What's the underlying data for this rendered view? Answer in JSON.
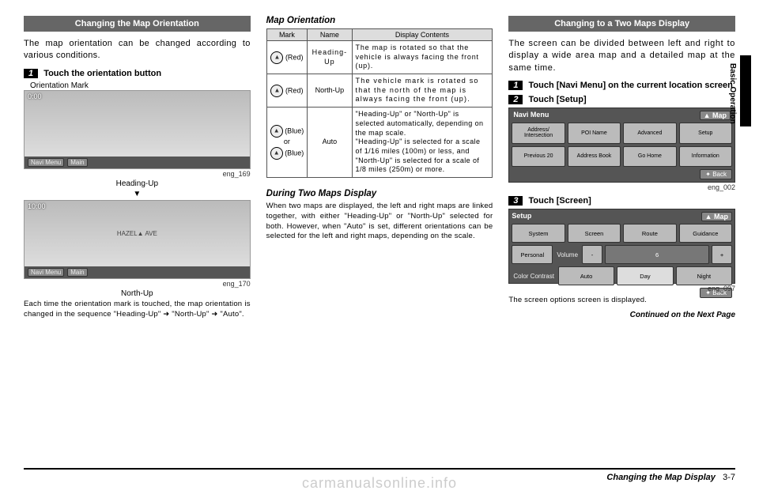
{
  "col1": {
    "header": "Changing the Map Orientation",
    "intro": "The map orientation can be changed according to various conditions.",
    "step1_num": "1",
    "step1_text": "Touch the orientation button",
    "img1_label": "Orientation Mark",
    "img1_cap_small": "eng_169",
    "img1_caption": "Heading-Up",
    "arrow": "▼",
    "img2_cap_small": "eng_170",
    "img2_caption": "North-Up",
    "fine": "Each time the orientation mark is touched, the map orientation is changed in the sequence \"Heading-Up\" ➜ \"North-Up\" ➜ \"Auto\"."
  },
  "col2": {
    "subhead1": "Map Orientation",
    "th_mark": "Mark",
    "th_name": "Name",
    "th_disp": "Display Contents",
    "row1_mark": "(Red)",
    "row1_name": "Heading-Up",
    "row1_disp": "The map is rotated so that the vehicle is always facing the front (up).",
    "row2_mark": "(Red)",
    "row2_name": "North-Up",
    "row2_disp": "The vehicle mark is rotated so that the north of the map is always facing the front (up).",
    "row3_mark1": "(Blue)",
    "row3_or": "or",
    "row3_mark2": "(Blue)",
    "row3_name": "Auto",
    "row3_disp": "\"Heading-Up\" or \"North-Up\" is selected automatically, depending on the map scale.\n\"Heading-Up\" is selected for a scale of 1/16 miles (100m) or less, and \"North-Up\" is selected for a scale of 1/8 miles (250m) or more.",
    "subhead2": "During Two Maps Display",
    "para2": "When two maps are displayed, the left and right maps are linked together, with either \"Heading-Up\" or \"North-Up\" selected for both. However, when \"Auto\" is set, different orientations can be selected for the left and right maps, depending on the scale."
  },
  "col3": {
    "header": "Changing to a Two Maps Display",
    "intro": "The screen can be divided between left and right to display a wide area map and a detailed map at the same time.",
    "step1_num": "1",
    "step1_text": "Touch [Navi Menu] on the current location screen",
    "step2_num": "2",
    "step2_text": "Touch [Setup]",
    "menu_title": "Navi Menu",
    "menu_map": "▲ Map",
    "menu_c1": "Address/ Intersection",
    "menu_c2": "POI Name",
    "menu_c3": "Advanced",
    "menu_c4": "Setup",
    "menu_c5": "Previous 20",
    "menu_c6": "Address Book",
    "menu_c7": "Go Home",
    "menu_c8": "Information",
    "menu_back": "✦ Back",
    "img2_cap_small": "eng_002",
    "step3_num": "3",
    "step3_text": "Touch [Screen]",
    "setup_title": "Setup",
    "setup_map": "▲ Map",
    "setup_c1": "System",
    "setup_c2": "Screen",
    "setup_c3": "Route",
    "setup_c4": "Guidance",
    "setup_r2_label": "Volume",
    "setup_r2_personal": "Personal",
    "setup_r2_minus": "-",
    "setup_r2_val": "6",
    "setup_r2_plus": "+",
    "setup_r3_label": "Color Contrast",
    "setup_r3_auto": "Auto",
    "setup_r3_day": "Day",
    "setup_r3_night": "Night",
    "setup_back": "✦ Back",
    "img3_cap_small": "eng_097",
    "result_text": "The screen options screen is displayed.",
    "continued": "Continued on the Next Page"
  },
  "side_label": "Basic Operation",
  "footer_title": "Changing the Map Display",
  "footer_page": "3-7",
  "watermark": "carmanualsonline.info",
  "map1": {
    "time": "0:00",
    "navi": "Navi Menu",
    "main": "Main"
  },
  "map2": {
    "time": "10:00",
    "navi": "Navi Menu",
    "main": "Main",
    "street": "HAZEL▲ AVE"
  }
}
